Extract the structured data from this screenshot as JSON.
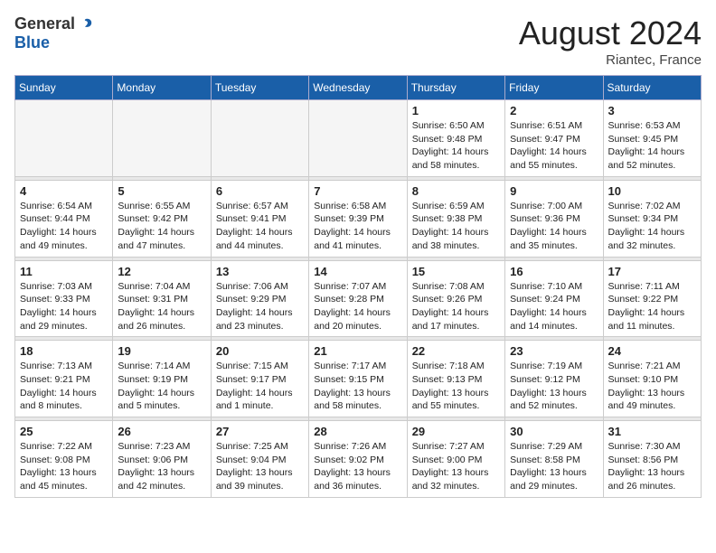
{
  "header": {
    "logo_general": "General",
    "logo_blue": "Blue",
    "month_year": "August 2024",
    "location": "Riantec, France"
  },
  "days_of_week": [
    "Sunday",
    "Monday",
    "Tuesday",
    "Wednesday",
    "Thursday",
    "Friday",
    "Saturday"
  ],
  "weeks": [
    [
      {
        "day": "",
        "info": ""
      },
      {
        "day": "",
        "info": ""
      },
      {
        "day": "",
        "info": ""
      },
      {
        "day": "",
        "info": ""
      },
      {
        "day": "1",
        "info": "Sunrise: 6:50 AM\nSunset: 9:48 PM\nDaylight: 14 hours\nand 58 minutes."
      },
      {
        "day": "2",
        "info": "Sunrise: 6:51 AM\nSunset: 9:47 PM\nDaylight: 14 hours\nand 55 minutes."
      },
      {
        "day": "3",
        "info": "Sunrise: 6:53 AM\nSunset: 9:45 PM\nDaylight: 14 hours\nand 52 minutes."
      }
    ],
    [
      {
        "day": "4",
        "info": "Sunrise: 6:54 AM\nSunset: 9:44 PM\nDaylight: 14 hours\nand 49 minutes."
      },
      {
        "day": "5",
        "info": "Sunrise: 6:55 AM\nSunset: 9:42 PM\nDaylight: 14 hours\nand 47 minutes."
      },
      {
        "day": "6",
        "info": "Sunrise: 6:57 AM\nSunset: 9:41 PM\nDaylight: 14 hours\nand 44 minutes."
      },
      {
        "day": "7",
        "info": "Sunrise: 6:58 AM\nSunset: 9:39 PM\nDaylight: 14 hours\nand 41 minutes."
      },
      {
        "day": "8",
        "info": "Sunrise: 6:59 AM\nSunset: 9:38 PM\nDaylight: 14 hours\nand 38 minutes."
      },
      {
        "day": "9",
        "info": "Sunrise: 7:00 AM\nSunset: 9:36 PM\nDaylight: 14 hours\nand 35 minutes."
      },
      {
        "day": "10",
        "info": "Sunrise: 7:02 AM\nSunset: 9:34 PM\nDaylight: 14 hours\nand 32 minutes."
      }
    ],
    [
      {
        "day": "11",
        "info": "Sunrise: 7:03 AM\nSunset: 9:33 PM\nDaylight: 14 hours\nand 29 minutes."
      },
      {
        "day": "12",
        "info": "Sunrise: 7:04 AM\nSunset: 9:31 PM\nDaylight: 14 hours\nand 26 minutes."
      },
      {
        "day": "13",
        "info": "Sunrise: 7:06 AM\nSunset: 9:29 PM\nDaylight: 14 hours\nand 23 minutes."
      },
      {
        "day": "14",
        "info": "Sunrise: 7:07 AM\nSunset: 9:28 PM\nDaylight: 14 hours\nand 20 minutes."
      },
      {
        "day": "15",
        "info": "Sunrise: 7:08 AM\nSunset: 9:26 PM\nDaylight: 14 hours\nand 17 minutes."
      },
      {
        "day": "16",
        "info": "Sunrise: 7:10 AM\nSunset: 9:24 PM\nDaylight: 14 hours\nand 14 minutes."
      },
      {
        "day": "17",
        "info": "Sunrise: 7:11 AM\nSunset: 9:22 PM\nDaylight: 14 hours\nand 11 minutes."
      }
    ],
    [
      {
        "day": "18",
        "info": "Sunrise: 7:13 AM\nSunset: 9:21 PM\nDaylight: 14 hours\nand 8 minutes."
      },
      {
        "day": "19",
        "info": "Sunrise: 7:14 AM\nSunset: 9:19 PM\nDaylight: 14 hours\nand 5 minutes."
      },
      {
        "day": "20",
        "info": "Sunrise: 7:15 AM\nSunset: 9:17 PM\nDaylight: 14 hours\nand 1 minute."
      },
      {
        "day": "21",
        "info": "Sunrise: 7:17 AM\nSunset: 9:15 PM\nDaylight: 13 hours\nand 58 minutes."
      },
      {
        "day": "22",
        "info": "Sunrise: 7:18 AM\nSunset: 9:13 PM\nDaylight: 13 hours\nand 55 minutes."
      },
      {
        "day": "23",
        "info": "Sunrise: 7:19 AM\nSunset: 9:12 PM\nDaylight: 13 hours\nand 52 minutes."
      },
      {
        "day": "24",
        "info": "Sunrise: 7:21 AM\nSunset: 9:10 PM\nDaylight: 13 hours\nand 49 minutes."
      }
    ],
    [
      {
        "day": "25",
        "info": "Sunrise: 7:22 AM\nSunset: 9:08 PM\nDaylight: 13 hours\nand 45 minutes."
      },
      {
        "day": "26",
        "info": "Sunrise: 7:23 AM\nSunset: 9:06 PM\nDaylight: 13 hours\nand 42 minutes."
      },
      {
        "day": "27",
        "info": "Sunrise: 7:25 AM\nSunset: 9:04 PM\nDaylight: 13 hours\nand 39 minutes."
      },
      {
        "day": "28",
        "info": "Sunrise: 7:26 AM\nSunset: 9:02 PM\nDaylight: 13 hours\nand 36 minutes."
      },
      {
        "day": "29",
        "info": "Sunrise: 7:27 AM\nSunset: 9:00 PM\nDaylight: 13 hours\nand 32 minutes."
      },
      {
        "day": "30",
        "info": "Sunrise: 7:29 AM\nSunset: 8:58 PM\nDaylight: 13 hours\nand 29 minutes."
      },
      {
        "day": "31",
        "info": "Sunrise: 7:30 AM\nSunset: 8:56 PM\nDaylight: 13 hours\nand 26 minutes."
      }
    ]
  ]
}
